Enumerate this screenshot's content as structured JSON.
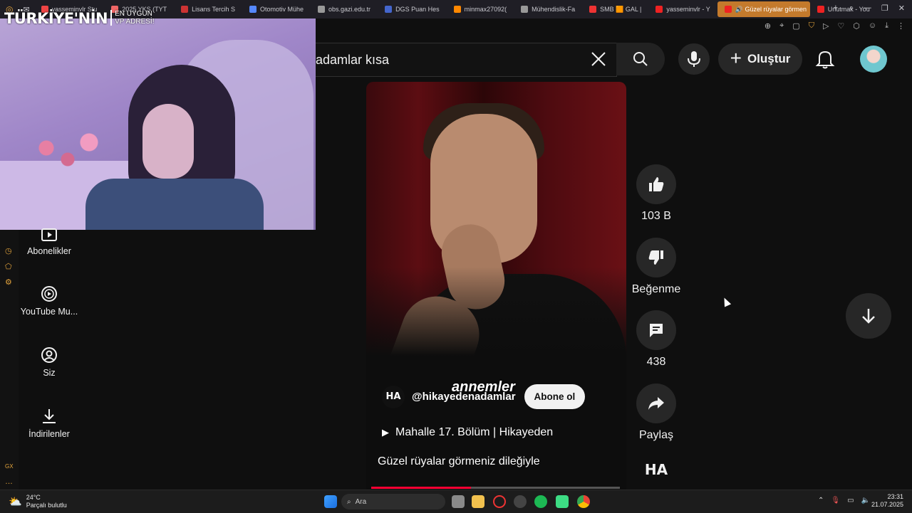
{
  "browser": {
    "tabs": [
      {
        "label": "yasseminvlr Stu",
        "color": "#e44"
      },
      {
        "label": "2025 YKS (TYT",
        "color": "#e66"
      },
      {
        "label": "Lisans Tercih S",
        "color": "#c33"
      },
      {
        "label": "Otomotiv Mühe",
        "color": "#58f"
      },
      {
        "label": "obs.gazi.edu.tr",
        "color": "#999"
      },
      {
        "label": "DGS Puan Hes",
        "color": "#46c"
      },
      {
        "label": "minmax27092(",
        "color": "#f80"
      },
      {
        "label": "Mühendislik-Fa",
        "color": "#999"
      },
      {
        "label": "SMB 🟧 GAL |",
        "color": "#e33"
      },
      {
        "label": "yasseminvlr - Y",
        "color": "#e22"
      },
      {
        "label": "🔊 Güzel rüyalar görmen",
        "color": "#e22",
        "active": true
      },
      {
        "label": "Unutmak - You",
        "color": "#e22"
      }
    ]
  },
  "stream_overlay": {
    "logo_main": "TÜRKİYE'NİN",
    "logo_sub1": "EN UYGUN",
    "logo_sub2": "VP ADRESİ!"
  },
  "search": {
    "query": "adamlar kısa"
  },
  "header": {
    "create_label": "Oluştur"
  },
  "sidebar": {
    "items": [
      {
        "label": "Abonelikler",
        "icon": "subscriptions-icon"
      },
      {
        "label": "YouTube Mu...",
        "icon": "youtube-music-icon"
      },
      {
        "label": "Siz",
        "icon": "account-icon"
      },
      {
        "label": "İndirilenler",
        "icon": "download-icon"
      }
    ]
  },
  "short": {
    "overlay_text": "annemler",
    "channel_handle": "@hikayedenadamlar",
    "channel_logo": "HA",
    "subscribe_label": "Abone ol",
    "playlist_title": "Mahalle 17. Bölüm | Hikayeden",
    "description": "Güzel rüyalar görmeniz dileğiyle",
    "progress": 0.4
  },
  "actions": {
    "likes": "103 B",
    "dislike_label": "Beğenme",
    "comments": "438",
    "share_label": "Paylaş",
    "audio_logo": "HA"
  },
  "taskbar": {
    "temperature": "24°C",
    "weather": "Parçalı bulutlu",
    "search_placeholder": "Ara",
    "time": "23:31",
    "date": "21.07.2025"
  }
}
